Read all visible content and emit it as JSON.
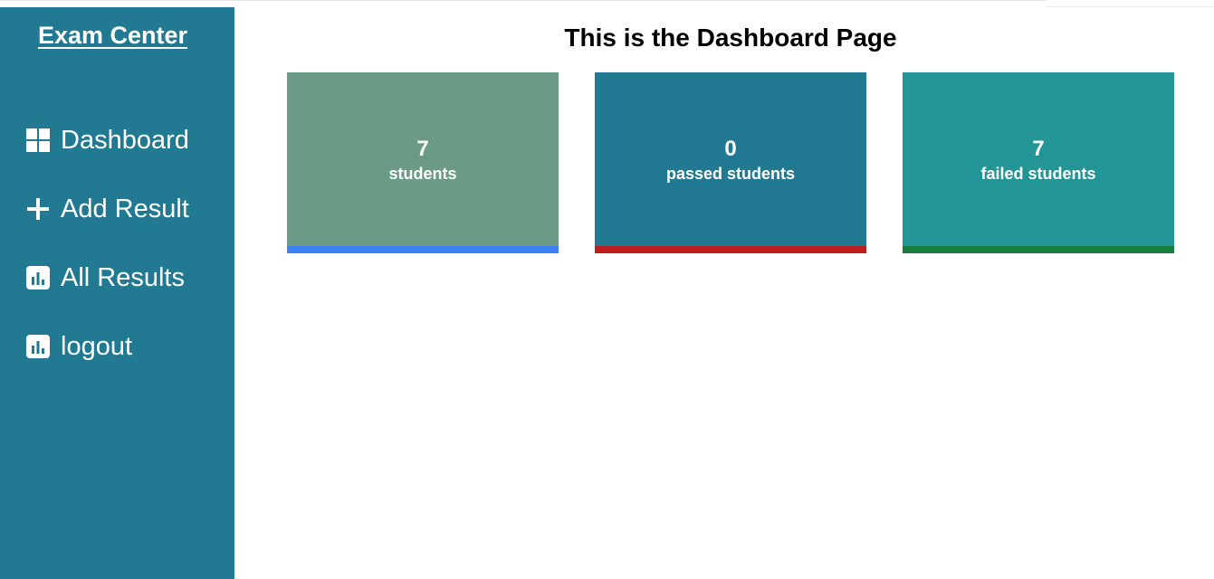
{
  "sidebar": {
    "brand": "Exam Center",
    "background": "#227a92",
    "items": [
      {
        "label": "Dashboard",
        "icon": "dashboard-grid-icon"
      },
      {
        "label": "Add Result",
        "icon": "plus-icon"
      },
      {
        "label": "All Results",
        "icon": "bar-chart-icon"
      },
      {
        "label": "logout",
        "icon": "bar-chart-icon"
      }
    ]
  },
  "main": {
    "title": "This is the Dashboard Page",
    "cards": [
      {
        "value": "7",
        "label": "students",
        "background": "#6b9a86",
        "stripe": "#3b82f6"
      },
      {
        "value": "0",
        "label": "passed students",
        "background": "#227a92",
        "stripe": "#c01f1f"
      },
      {
        "value": "7",
        "label": "failed students",
        "background": "#239596",
        "stripe": "#177d3d"
      }
    ]
  }
}
